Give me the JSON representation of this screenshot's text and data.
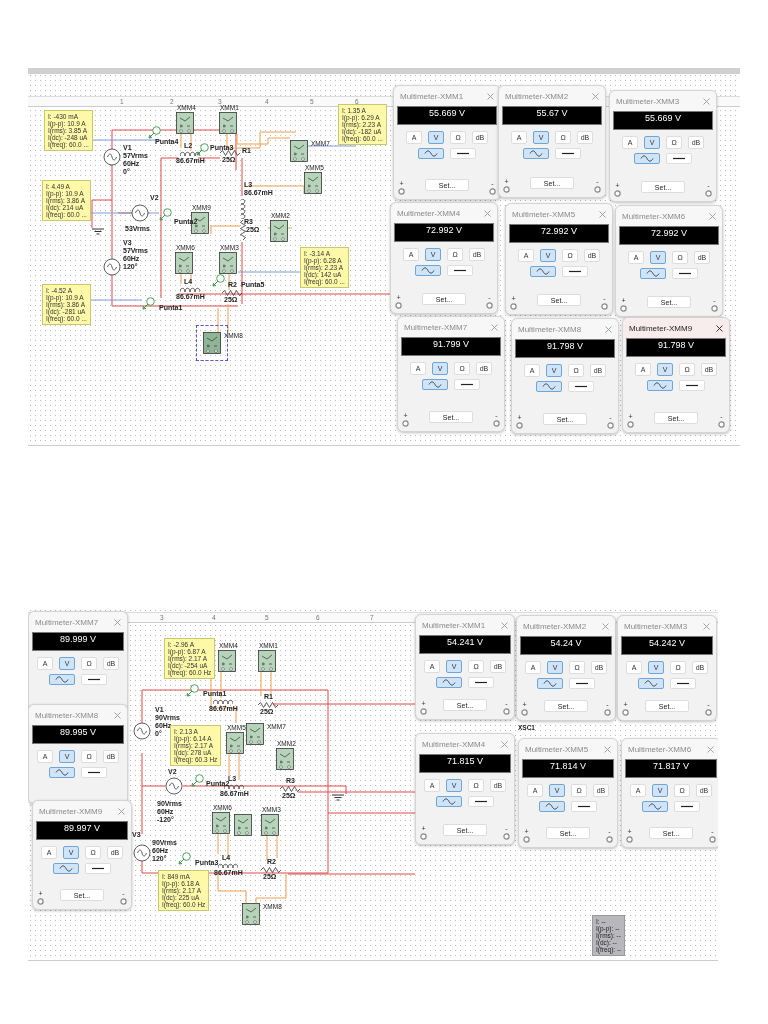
{
  "screenshots": [
    {
      "ruler": [
        "1",
        "2",
        "3",
        "4",
        "5",
        "6"
      ],
      "readouts": [
        {
          "active": true,
          "lines": [
            "I: -430 mA",
            "I(p-p): 10.9 A",
            "I(rms): 3.85 A",
            "I(dc): -248 uA",
            "I(freq): 60.0 ..."
          ]
        },
        {
          "active": true,
          "lines": [
            "I: 4.49 A",
            "I(p-p): 10.9 A",
            "I(rms): 3.86 A",
            "I(dc): 214 uA",
            "I(freq): 60.0 ..."
          ]
        },
        {
          "active": true,
          "lines": [
            "I: -4.52 A",
            "I(p-p): 10.9 A",
            "I(rms): 3.86 A",
            "I(dc): -281 uA",
            "I(freq): 60.0 ..."
          ]
        },
        {
          "active": true,
          "lines": [
            "I: 1.35 A",
            "I(p-p): 6.29 A",
            "I(rms): 2.23 A",
            "I(dc): -182 uA",
            "I(freq): 60.0 ..."
          ]
        },
        {
          "active": true,
          "lines": [
            "I: -3.14 A",
            "I(p-p): 6.28 A",
            "I(rms): 2.23 A",
            "I(dc): 142 uA",
            "I(freq): 60.0 ..."
          ]
        }
      ],
      "instruments": [
        {
          "label": "XMM4",
          "selected": false
        },
        {
          "label": "XMM1",
          "selected": false
        },
        {
          "label": "XMM7",
          "selected": false
        },
        {
          "label": "XMM5",
          "selected": false
        },
        {
          "label": "XMM9",
          "selected": false
        },
        {
          "label": "XMM2",
          "selected": false
        },
        {
          "label": "XMM6",
          "selected": false
        },
        {
          "label": "XMM3",
          "selected": false
        },
        {
          "label": "XMM8",
          "selected": true
        }
      ],
      "sources": [
        {
          "name": "V1",
          "lines": [
            "57Vrms",
            "60Hz",
            "0°"
          ]
        },
        {
          "name": "V2",
          "lines": [
            "53Vrms"
          ]
        },
        {
          "name": "V3",
          "lines": [
            "57Vrms",
            "60Hz",
            "120°"
          ]
        }
      ],
      "inductors": [
        {
          "name": "L2",
          "value": "86.67mH",
          "vertical": false
        },
        {
          "name": "L3",
          "value": "86.67mH",
          "vertical": true
        },
        {
          "name": "L4",
          "value": "86.67mH",
          "vertical": false
        }
      ],
      "resistors": [
        {
          "name": "R1",
          "value": "25Ω",
          "vertical": false
        },
        {
          "name": "R3",
          "value": "25Ω",
          "vertical": true
        },
        {
          "name": "R2",
          "value": "25Ω",
          "vertical": false
        }
      ],
      "probes": [
        {
          "label": "Punta4"
        },
        {
          "label": "Punta3"
        },
        {
          "label": "Punta2"
        },
        {
          "label": "Punta1"
        },
        {
          "label": "Punta5"
        }
      ],
      "windows": [
        {
          "title": "Multimeter-XMM1",
          "reading": "55.669 V",
          "focused": false,
          "functions": [
            {
              "label": "A",
              "selected": false
            },
            {
              "label": "V",
              "selected": true
            },
            {
              "label": "Ω",
              "selected": false
            },
            {
              "label": "dB",
              "selected": false
            }
          ],
          "coupling": [
            {
              "kind": "ac",
              "selected": true
            },
            {
              "kind": "dc",
              "selected": false
            }
          ],
          "set_label": "Set...",
          "plus": "+",
          "minus": "-"
        },
        {
          "title": "Multimeter-XMM2",
          "reading": "55.67 V",
          "focused": false,
          "functions": [
            {
              "label": "A",
              "selected": false
            },
            {
              "label": "V",
              "selected": true
            },
            {
              "label": "Ω",
              "selected": false
            },
            {
              "label": "dB",
              "selected": false
            }
          ],
          "coupling": [
            {
              "kind": "ac",
              "selected": true
            },
            {
              "kind": "dc",
              "selected": false
            }
          ],
          "set_label": "Set...",
          "plus": "+",
          "minus": "-"
        },
        {
          "title": "Multimeter-XMM3",
          "reading": "55.669 V",
          "focused": false,
          "functions": [
            {
              "label": "A",
              "selected": false
            },
            {
              "label": "V",
              "selected": true
            },
            {
              "label": "Ω",
              "selected": false
            },
            {
              "label": "dB",
              "selected": false
            }
          ],
          "coupling": [
            {
              "kind": "ac",
              "selected": true
            },
            {
              "kind": "dc",
              "selected": false
            }
          ],
          "set_label": "Set...",
          "plus": "+",
          "minus": "-"
        },
        {
          "title": "Multimeter-XMM4",
          "reading": "72.992 V",
          "focused": false,
          "functions": [
            {
              "label": "A",
              "selected": false
            },
            {
              "label": "V",
              "selected": true
            },
            {
              "label": "Ω",
              "selected": false
            },
            {
              "label": "dB",
              "selected": false
            }
          ],
          "coupling": [
            {
              "kind": "ac",
              "selected": true
            },
            {
              "kind": "dc",
              "selected": false
            }
          ],
          "set_label": "Set...",
          "plus": "+",
          "minus": "-"
        },
        {
          "title": "Multimeter-XMM5",
          "reading": "72.992 V",
          "focused": false,
          "functions": [
            {
              "label": "A",
              "selected": false
            },
            {
              "label": "V",
              "selected": true
            },
            {
              "label": "Ω",
              "selected": false
            },
            {
              "label": "dB",
              "selected": false
            }
          ],
          "coupling": [
            {
              "kind": "ac",
              "selected": true
            },
            {
              "kind": "dc",
              "selected": false
            }
          ],
          "set_label": "Set...",
          "plus": "+",
          "minus": "-"
        },
        {
          "title": "Multimeter-XMM6",
          "reading": "72.992 V",
          "focused": false,
          "functions": [
            {
              "label": "A",
              "selected": false
            },
            {
              "label": "V",
              "selected": true
            },
            {
              "label": "Ω",
              "selected": false
            },
            {
              "label": "dB",
              "selected": false
            }
          ],
          "coupling": [
            {
              "kind": "ac",
              "selected": true
            },
            {
              "kind": "dc",
              "selected": false
            }
          ],
          "set_label": "Set...",
          "plus": "+",
          "minus": "-"
        },
        {
          "title": "Multimeter-XMM7",
          "reading": "91.799 V",
          "focused": false,
          "functions": [
            {
              "label": "A",
              "selected": false
            },
            {
              "label": "V",
              "selected": true
            },
            {
              "label": "Ω",
              "selected": false
            },
            {
              "label": "dB",
              "selected": false
            }
          ],
          "coupling": [
            {
              "kind": "ac",
              "selected": true
            },
            {
              "kind": "dc",
              "selected": false
            }
          ],
          "set_label": "Set...",
          "plus": "+",
          "minus": "-"
        },
        {
          "title": "Multimeter-XMM8",
          "reading": "91.798 V",
          "focused": false,
          "functions": [
            {
              "label": "A",
              "selected": false
            },
            {
              "label": "V",
              "selected": true
            },
            {
              "label": "Ω",
              "selected": false
            },
            {
              "label": "dB",
              "selected": false
            }
          ],
          "coupling": [
            {
              "kind": "ac",
              "selected": true
            },
            {
              "kind": "dc",
              "selected": false
            }
          ],
          "set_label": "Set...",
          "plus": "+",
          "minus": "-"
        },
        {
          "title": "Multimeter-XMM9",
          "reading": "91.798 V",
          "focused": true,
          "functions": [
            {
              "label": "A",
              "selected": false
            },
            {
              "label": "V",
              "selected": true
            },
            {
              "label": "Ω",
              "selected": false
            },
            {
              "label": "dB",
              "selected": false
            }
          ],
          "coupling": [
            {
              "kind": "ac",
              "selected": true
            },
            {
              "kind": "dc",
              "selected": false
            }
          ],
          "set_label": "Set...",
          "plus": "+",
          "minus": "-"
        }
      ]
    },
    {
      "ruler": [
        "3",
        "4",
        "5",
        "6",
        "7"
      ],
      "readouts": [
        {
          "active": true,
          "lines": [
            "I: -2.96 A",
            "I(p-p): 6.87 A",
            "I(rms): 2.17 A",
            "I(dc): -254 uA",
            "I(freq): 60.0 Hz"
          ]
        },
        {
          "active": true,
          "lines": [
            "I: 2.13 A",
            "I(p-p): 6.14 A",
            "I(rms): 2.17 A",
            "I(dc): 278 uA",
            "I(freq): 60.3 Hz"
          ]
        },
        {
          "active": true,
          "lines": [
            "I: 849 mA",
            "I(p-p): 6.18 A",
            "I(rms): 2.17 A",
            "I(dc): 225 uA",
            "I(freq): 60.0 Hz"
          ]
        },
        {
          "active": false,
          "lines": [
            "I: --",
            "I(p-p): --",
            "I(rms): --",
            "I(dc): --",
            "I(freq): --"
          ]
        }
      ],
      "instruments": [
        {
          "label": "XMM4",
          "selected": false
        },
        {
          "label": "XMM1",
          "selected": false
        },
        {
          "label": "XMM7",
          "selected": false
        },
        {
          "label": "XMM5",
          "selected": false
        },
        {
          "label": "XMM2",
          "selected": false
        },
        {
          "label": "XMM6",
          "selected": false
        },
        {
          "selected": false
        },
        {
          "label": "XMM3",
          "selected": false
        },
        {
          "label": "XMM8",
          "selected": false
        }
      ],
      "sources": [
        {
          "name": "V1",
          "lines": [
            "90Vrms",
            "60Hz",
            "0°"
          ]
        },
        {
          "name": "V2",
          "lines": [
            "90Vrms",
            "60Hz",
            "-120°"
          ]
        },
        {
          "name": "V3",
          "lines": [
            "90Vrms",
            "60Hz",
            "120°"
          ]
        }
      ],
      "inductors": [
        {
          "value": "86.67mH",
          "vertical": false
        },
        {
          "name": "L3",
          "value": "86.67mH",
          "vertical": false
        },
        {
          "name": "L4",
          "value": "86.67mH",
          "vertical": false
        }
      ],
      "resistors": [
        {
          "name": "R1",
          "value": "25Ω",
          "vertical": false
        },
        {
          "name": "R3",
          "value": "25Ω",
          "vertical": false
        },
        {
          "name": "R2",
          "value": "25Ω",
          "vertical": false
        }
      ],
      "probes": [
        {
          "label": "Punta1"
        },
        {
          "label": "Punta2"
        },
        {
          "label": "Punta3"
        }
      ],
      "notes": [
        "XSC1"
      ],
      "windows": [
        {
          "title": "Multimeter-XMM7",
          "reading": "89.999 V",
          "focused": false,
          "functions": [
            {
              "label": "A",
              "selected": false
            },
            {
              "label": "V",
              "selected": true
            },
            {
              "label": "Ω",
              "selected": false
            },
            {
              "label": "dB",
              "selected": false
            }
          ],
          "coupling": [
            {
              "kind": "ac",
              "selected": true
            },
            {
              "kind": "dc",
              "selected": false
            }
          ]
        },
        {
          "title": "Multimeter-XMM8",
          "reading": "89.995 V",
          "focused": false,
          "functions": [
            {
              "label": "A",
              "selected": false
            },
            {
              "label": "V",
              "selected": true
            },
            {
              "label": "Ω",
              "selected": false
            },
            {
              "label": "dB",
              "selected": false
            }
          ],
          "coupling": [
            {
              "kind": "ac",
              "selected": true
            },
            {
              "kind": "dc",
              "selected": false
            }
          ]
        },
        {
          "title": "Multimeter-XMM9",
          "reading": "89.997 V",
          "focused": false,
          "functions": [
            {
              "label": "A",
              "selected": false
            },
            {
              "label": "V",
              "selected": true
            },
            {
              "label": "Ω",
              "selected": false
            },
            {
              "label": "dB",
              "selected": false
            }
          ],
          "coupling": [
            {
              "kind": "ac",
              "selected": true
            },
            {
              "kind": "dc",
              "selected": false
            }
          ],
          "set_label": "Set...",
          "plus": "+",
          "minus": "-"
        },
        {
          "title": "Multimeter-XMM1",
          "reading": "54.241 V",
          "focused": false,
          "functions": [
            {
              "label": "A",
              "selected": false
            },
            {
              "label": "V",
              "selected": true
            },
            {
              "label": "Ω",
              "selected": false
            },
            {
              "label": "dB",
              "selected": false
            }
          ],
          "coupling": [
            {
              "kind": "ac",
              "selected": true
            },
            {
              "kind": "dc",
              "selected": false
            }
          ],
          "set_label": "Set...",
          "plus": "+",
          "minus": "-"
        },
        {
          "title": "Multimeter-XMM2",
          "reading": "54.24 V",
          "focused": false,
          "functions": [
            {
              "label": "A",
              "selected": false
            },
            {
              "label": "V",
              "selected": true
            },
            {
              "label": "Ω",
              "selected": false
            },
            {
              "label": "dB",
              "selected": false
            }
          ],
          "coupling": [
            {
              "kind": "ac",
              "selected": true
            },
            {
              "kind": "dc",
              "selected": false
            }
          ],
          "set_label": "Set...",
          "plus": "+",
          "minus": "-"
        },
        {
          "title": "Multimeter-XMM3",
          "reading": "54.242 V",
          "focused": false,
          "functions": [
            {
              "label": "A",
              "selected": false
            },
            {
              "label": "V",
              "selected": true
            },
            {
              "label": "Ω",
              "selected": false
            },
            {
              "label": "dB",
              "selected": false
            }
          ],
          "coupling": [
            {
              "kind": "ac",
              "selected": true
            },
            {
              "kind": "dc",
              "selected": false
            }
          ],
          "set_label": "Set...",
          "plus": "+",
          "minus": "-"
        },
        {
          "title": "Multimeter-XMM4",
          "reading": "71.815 V",
          "focused": false,
          "functions": [
            {
              "label": "A",
              "selected": false
            },
            {
              "label": "V",
              "selected": true
            },
            {
              "label": "Ω",
              "selected": false
            },
            {
              "label": "dB",
              "selected": false
            }
          ],
          "coupling": [
            {
              "kind": "ac",
              "selected": true
            },
            {
              "kind": "dc",
              "selected": false
            }
          ],
          "set_label": "Set...",
          "plus": "+",
          "minus": "-"
        },
        {
          "title": "Multimeter-XMM5",
          "reading": "71.814 V",
          "focused": false,
          "functions": [
            {
              "label": "A",
              "selected": false
            },
            {
              "label": "V",
              "selected": true
            },
            {
              "label": "Ω",
              "selected": false
            },
            {
              "label": "dB",
              "selected": false
            }
          ],
          "coupling": [
            {
              "kind": "ac",
              "selected": true
            },
            {
              "kind": "dc",
              "selected": false
            }
          ],
          "set_label": "Set...",
          "plus": "+",
          "minus": "-"
        },
        {
          "title": "Multimeter-XMM6",
          "reading": "71.817 V",
          "focused": false,
          "functions": [
            {
              "label": "A",
              "selected": false
            },
            {
              "label": "V",
              "selected": true
            },
            {
              "label": "Ω",
              "selected": false
            },
            {
              "label": "dB",
              "selected": false
            }
          ],
          "coupling": [
            {
              "kind": "ac",
              "selected": true
            },
            {
              "kind": "dc",
              "selected": false
            }
          ],
          "set_label": "Set...",
          "plus": "+",
          "minus": "-"
        }
      ]
    }
  ]
}
